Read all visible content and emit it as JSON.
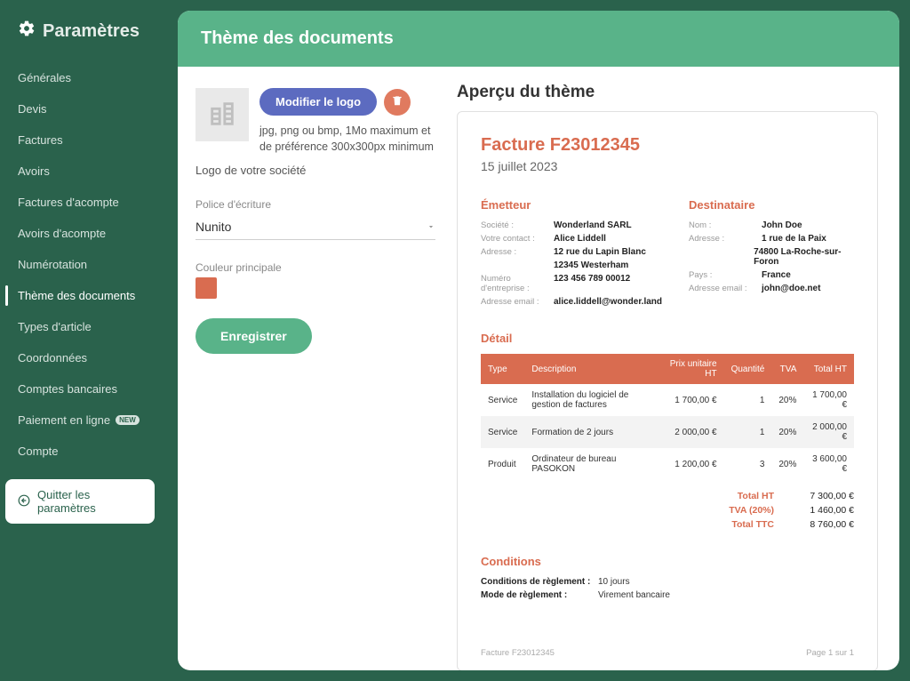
{
  "accent_color": "#d96c50",
  "sidebar": {
    "title": "Paramètres",
    "items": [
      {
        "label": "Générales"
      },
      {
        "label": "Devis"
      },
      {
        "label": "Factures"
      },
      {
        "label": "Avoirs"
      },
      {
        "label": "Factures d'acompte"
      },
      {
        "label": "Avoirs d'acompte"
      },
      {
        "label": "Numérotation"
      },
      {
        "label": "Thème des documents",
        "active": true
      },
      {
        "label": "Types d'article"
      },
      {
        "label": "Coordonnées"
      },
      {
        "label": "Comptes bancaires"
      },
      {
        "label": "Paiement en ligne",
        "badge": "NEW"
      },
      {
        "label": "Compte"
      }
    ],
    "quit_label": "Quitter les paramètres"
  },
  "page": {
    "title": "Thème des documents",
    "logo": {
      "modify_label": "Modifier le logo",
      "hint": "jpg, png ou bmp, 1Mo maximum et de préférence 300x300px minimum",
      "caption": "Logo de votre société"
    },
    "font": {
      "label": "Police d'écriture",
      "value": "Nunito"
    },
    "color": {
      "label": "Couleur principale"
    },
    "save_label": "Enregistrer"
  },
  "preview": {
    "title": "Aperçu du thème",
    "doc_title": "Facture F23012345",
    "doc_date": "15 juillet 2023",
    "sender": {
      "heading": "Émetteur",
      "rows": [
        {
          "k": "Société :",
          "v": "Wonderland SARL"
        },
        {
          "k": "Votre contact :",
          "v": "Alice Liddell"
        },
        {
          "k": "Adresse :",
          "v": "12 rue du Lapin Blanc"
        },
        {
          "k": "",
          "v": "12345 Westerham"
        },
        {
          "k": "Numéro d'entreprise :",
          "v": "123 456 789 00012"
        },
        {
          "k": "Adresse email :",
          "v": "alice.liddell@wonder.land"
        }
      ]
    },
    "recipient": {
      "heading": "Destinataire",
      "rows": [
        {
          "k": "Nom :",
          "v": "John Doe"
        },
        {
          "k": "Adresse :",
          "v": "1 rue de la Paix"
        },
        {
          "k": "",
          "v": "74800 La-Roche-sur-Foron"
        },
        {
          "k": "Pays :",
          "v": "France"
        },
        {
          "k": "Adresse email :",
          "v": "john@doe.net"
        }
      ]
    },
    "detail": {
      "heading": "Détail",
      "columns": [
        "Type",
        "Description",
        "Prix unitaire HT",
        "Quantité",
        "TVA",
        "Total HT"
      ],
      "rows": [
        {
          "type": "Service",
          "desc": "Installation du logiciel de gestion de factures",
          "pu": "1 700,00 €",
          "qty": "1",
          "tva": "20%",
          "total": "1 700,00 €"
        },
        {
          "type": "Service",
          "desc": "Formation de 2 jours",
          "pu": "2 000,00 €",
          "qty": "1",
          "tva": "20%",
          "total": "2 000,00 €"
        },
        {
          "type": "Produit",
          "desc": "Ordinateur de bureau PASOKON",
          "pu": "1 200,00 €",
          "qty": "3",
          "tva": "20%",
          "total": "3 600,00 €"
        }
      ],
      "totals": [
        {
          "label": "Total HT",
          "value": "7 300,00 €"
        },
        {
          "label": "TVA (20%)",
          "value": "1 460,00 €"
        },
        {
          "label": "Total TTC",
          "value": "8 760,00 €"
        }
      ]
    },
    "conditions": {
      "heading": "Conditions",
      "rows": [
        {
          "k": "Conditions de règlement :",
          "v": "10 jours"
        },
        {
          "k": "Mode de règlement :",
          "v": "Virement bancaire"
        }
      ]
    },
    "footer_left": "Facture F23012345",
    "footer_right": "Page 1 sur 1"
  }
}
